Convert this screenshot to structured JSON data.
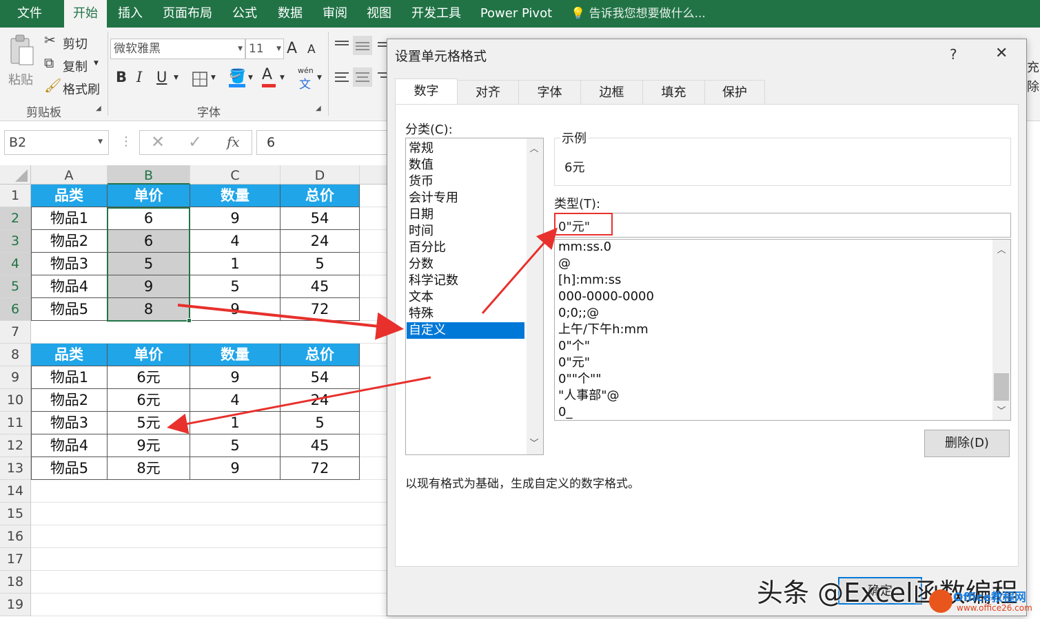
{
  "ribbon_tabs": [
    "文件",
    "开始",
    "插入",
    "页面布局",
    "公式",
    "数据",
    "审阅",
    "视图",
    "开发工具",
    "Power Pivot"
  ],
  "tell_me": "告诉我您想要做什么...",
  "clipboard": {
    "paste": "粘贴",
    "cut": "剪切",
    "copy": "复制",
    "format_painter": "格式刷",
    "group_label": "剪贴板"
  },
  "font": {
    "name": "微软雅黑",
    "size": "11",
    "group_label": "字体",
    "bold": "B",
    "italic": "I",
    "underline": "U",
    "grow": "A",
    "shrink": "A",
    "font_color": "A",
    "phonetic": "wén"
  },
  "formula_bar": {
    "name_box": "B2",
    "fx": "fx",
    "value": "6"
  },
  "sheet": {
    "columns": [
      "A",
      "B",
      "C",
      "D"
    ],
    "rows": [
      "1",
      "2",
      "3",
      "4",
      "5",
      "6",
      "7",
      "8",
      "9",
      "10",
      "11",
      "12",
      "13",
      "14",
      "15",
      "16",
      "17",
      "18",
      "19"
    ],
    "table1": {
      "headers": [
        "品类",
        "单价",
        "数量",
        "总价"
      ],
      "rows": [
        [
          "物品1",
          "6",
          "9",
          "54"
        ],
        [
          "物品2",
          "6",
          "4",
          "24"
        ],
        [
          "物品3",
          "5",
          "1",
          "5"
        ],
        [
          "物品4",
          "9",
          "5",
          "45"
        ],
        [
          "物品5",
          "8",
          "9",
          "72"
        ]
      ]
    },
    "table2": {
      "headers": [
        "品类",
        "单价",
        "数量",
        "总价"
      ],
      "rows": [
        [
          "物品1",
          "6元",
          "9",
          "54"
        ],
        [
          "物品2",
          "6元",
          "4",
          "24"
        ],
        [
          "物品3",
          "5元",
          "1",
          "5"
        ],
        [
          "物品4",
          "9元",
          "5",
          "45"
        ],
        [
          "物品5",
          "8元",
          "9",
          "72"
        ]
      ]
    }
  },
  "dialog": {
    "title": "设置单元格格式",
    "help": "?",
    "close": "✕",
    "tabs": [
      "数字",
      "对齐",
      "字体",
      "边框",
      "填充",
      "保护"
    ],
    "category_label": "分类(C):",
    "categories": [
      "常规",
      "数值",
      "货币",
      "会计专用",
      "日期",
      "时间",
      "百分比",
      "分数",
      "科学记数",
      "文本",
      "特殊",
      "自定义"
    ],
    "selected_category": "自定义",
    "sample_label": "示例",
    "sample_value": "6元",
    "type_label": "类型(T):",
    "type_value": "0\"元\"",
    "type_list": [
      "mm:ss.0",
      "@",
      "[h]:mm:ss",
      "000-0000-0000",
      "0;0;;@",
      "上午/下午h:mm",
      "0\"个\"",
      "0\"元\"",
      "0\"\"个\"\"",
      "\"人事部\"@",
      "0_"
    ],
    "delete_button": "删除(D)",
    "description": "以现有格式为基础，生成自定义的数字格式。",
    "ok_button": "确定"
  },
  "watermark": "头条 @Excel函数编程",
  "logo": {
    "name": "Office教程网",
    "url": "www.office26.com"
  },
  "colors": {
    "excel_green": "#217346",
    "table_header": "#1fa5e8",
    "selection_blue": "#0078d7",
    "arrow_red": "#e8302c"
  }
}
